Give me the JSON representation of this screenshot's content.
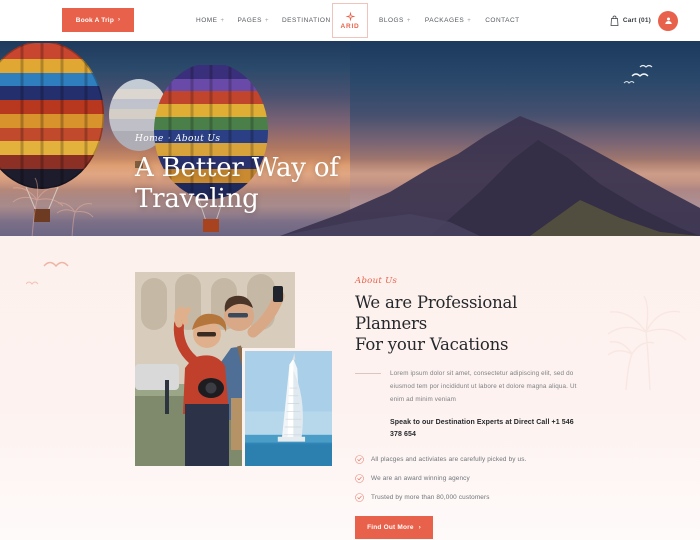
{
  "header": {
    "book_button": {
      "label": "Book A Trip",
      "arrow": "›",
      "icon": "arrow-right-icon"
    },
    "nav_left": [
      {
        "label": "HOME",
        "has_dropdown": true
      },
      {
        "label": "PAGES",
        "has_dropdown": true
      },
      {
        "label": "DESTINATION",
        "has_dropdown": true
      }
    ],
    "nav_right": [
      {
        "label": "BLOGS",
        "has_dropdown": true
      },
      {
        "label": "PACKAGES",
        "has_dropdown": true
      },
      {
        "label": "CONTACT",
        "has_dropdown": false
      }
    ],
    "dropdown_marker": "+",
    "logo": {
      "text": "ARID",
      "icon": "compass-icon"
    },
    "cart": {
      "label": "Cart (01)",
      "icon": "shopping-bag-icon"
    },
    "account": {
      "icon": "user-icon"
    }
  },
  "hero": {
    "breadcrumb": {
      "home": "Home",
      "separator": "·",
      "current": "About Us"
    },
    "title_line1": "A Better Way of",
    "title_line2": "Traveling",
    "image_alt": "hot-air-balloons-over-mountain-sunset"
  },
  "about": {
    "eyebrow": "About Us",
    "title_line1": "We are Professional Planners",
    "title_line2": "For your Vacations",
    "paragraph": "Lorem ipsum dolor sit amet, consectetur adipiscing elit, sed do eiusmod tem por incididunt ut labore et dolore magna aliqua. Ut enim ad minim veniam",
    "phone_line": "Speak to our Destination Experts at Direct Call +1 546 378 654",
    "features": [
      "All placges and activiates are carefully picked by us.",
      "We are an award winning agency",
      "Trusted by more than 80,000 customers"
    ],
    "cta": {
      "label": "Find Out More",
      "arrow": "›"
    },
    "photo_main_alt": "couple-taking-selfie",
    "photo_sub_alt": "burj-al-arab-hotel"
  },
  "colors": {
    "accent": "#e8614a",
    "section_bg": "#fdf1ee",
    "heading": "#25282c",
    "body_text": "#7c8086"
  }
}
